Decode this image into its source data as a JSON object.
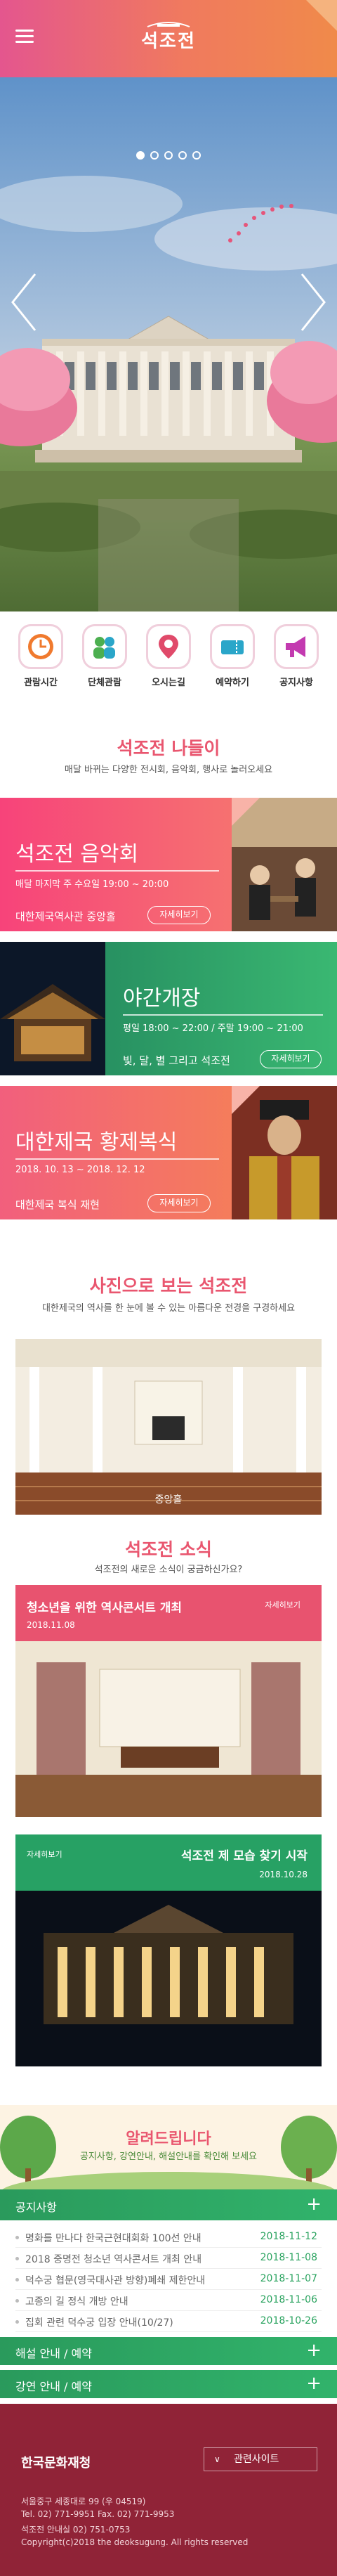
{
  "header": {
    "logo_text": "석조전",
    "menu_icon": "hamburger-icon"
  },
  "hero": {
    "slide_count": 5,
    "active_slide": 1
  },
  "quick_menu": [
    {
      "label": "관람시간",
      "icon": "clock-icon",
      "color": "#f07a2e"
    },
    {
      "label": "단체관람",
      "icon": "group-icon",
      "color": "#4caf50"
    },
    {
      "label": "오시는길",
      "icon": "location-pin-icon",
      "color": "#e04a6a"
    },
    {
      "label": "예약하기",
      "icon": "ticket-icon",
      "color": "#2aa6c9"
    },
    {
      "label": "공지사항",
      "icon": "megaphone-icon",
      "color": "#c33ab0"
    }
  ],
  "outing": {
    "title": "석조전 나들이",
    "subtitle": "매달 바뀌는 다양한 전시회, 음악회, 행사로 놀러오세요"
  },
  "banners": [
    {
      "title": "석조전 음악회",
      "info": "매달 마지막 주 수요일 19:00 ~ 20:00",
      "place": "대한제국역사관 중앙홀",
      "button": "자세히보기",
      "color_a": "#f7437a",
      "color_b": "#f5866c"
    },
    {
      "title": "야간개장",
      "info": "평일 18:00 ~ 22:00 / 주말 19:00 ~ 21:00",
      "place": "빛, 달, 별 그리고 석조전",
      "button": "자세히보기",
      "color_a": "#1f7f5a",
      "color_b": "#3ab872"
    },
    {
      "title": "대한제국 황제복식",
      "info": "2018. 10. 13 ~ 2018. 12. 12",
      "place": "대한제국 복식 재현",
      "button": "자세히보기",
      "color_a": "#f25f7d",
      "color_b": "#f68a4c"
    }
  ],
  "photo_section": {
    "title": "사진으로 보는 석조전",
    "subtitle": "대한제국의 역사를 한 눈에 볼 수 있는 아름다운 전경을 구경하세요",
    "photo_label": "중앙홀"
  },
  "news_section": {
    "title": "석조전 소식",
    "subtitle": "석조전의 새로운 소식이 궁금하신가요?"
  },
  "news_cards": [
    {
      "title": "청소년을 위한 역사콘서트 개최",
      "date": "2018.11.08",
      "more": "자세히보기"
    },
    {
      "title": "석조전 제 모습 찾기 시작",
      "date": "2018.10.28",
      "more": "자세히보기"
    }
  ],
  "announce": {
    "title": "알려드립니다",
    "subtitle": "공지사항, 강연안내, 해설안내를 확인해 보세요"
  },
  "notice": {
    "title": "공지사항",
    "rows": [
      {
        "text": "명화를 만나다 한국근현대회화 100선 안내",
        "date": "2018-11-12"
      },
      {
        "text": "2018 중명전 청소년 역사콘서트 개최 안내",
        "date": "2018-11-08"
      },
      {
        "text": "덕수궁 협문(영국대사관 방향)폐쇄 제한안내",
        "date": "2018-11-07"
      },
      {
        "text": "고종의 길 정식 개방 안내",
        "date": "2018-11-06"
      },
      {
        "text": "집회 관련 덕수궁 입장 안내(10/27)",
        "date": "2018-10-26"
      }
    ]
  },
  "accordions": [
    {
      "title": "해설 안내 / 예약"
    },
    {
      "title": "강연 안내 / 예약"
    }
  ],
  "footer": {
    "org": "한국문화재청",
    "related": "관련사이트",
    "address": "서울중구 세종대로 99 (우 04519)",
    "phone": "Tel. 02) 771-9951 Fax. 02) 771-9953",
    "desk": "석조전 안내실 02) 751-0753",
    "copyright": "Copyright(c)2018 the deoksugung. All rights reserved"
  }
}
